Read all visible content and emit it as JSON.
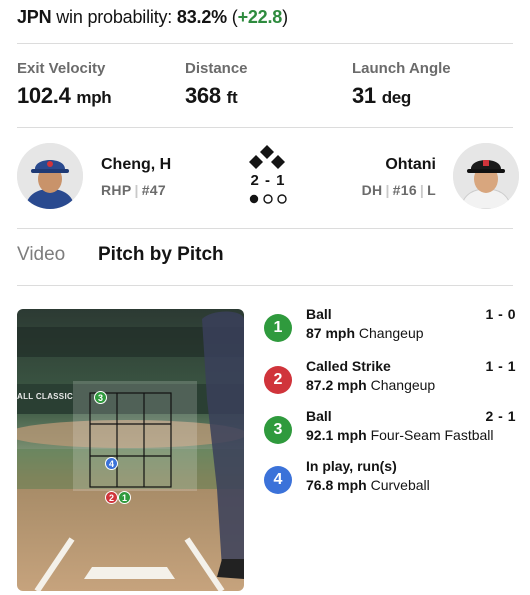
{
  "win_probability": {
    "team": "JPN",
    "label": "win probability:",
    "value": "83.2%",
    "open_paren": "(",
    "delta": "+22.8",
    "close_paren": ")",
    "delta_color": "#2e8b3e"
  },
  "stats": [
    {
      "label": "Exit Velocity",
      "value": "102.4",
      "unit": "mph"
    },
    {
      "label": "Distance",
      "value": "368",
      "unit": "ft"
    },
    {
      "label": "Launch Angle",
      "value": "31",
      "unit": "deg"
    }
  ],
  "pitcher": {
    "name": "Cheng, H",
    "position": "RHP",
    "number": "#47",
    "cap_color": "#2a4a8f"
  },
  "batter": {
    "name": "Ohtani",
    "position": "DH",
    "number": "#16",
    "bats": "L",
    "cap_color": "#1a1a1a"
  },
  "count": {
    "balls_strikes": "2 - 1",
    "outs": 1,
    "outs_max": 3,
    "bases_occupied": []
  },
  "tabs": [
    {
      "label": "Video",
      "active": false
    },
    {
      "label": "Pitch by Pitch",
      "active": true
    }
  ],
  "zone": {
    "signage": "ALL CLASSIC"
  },
  "pitches": [
    {
      "number": "1",
      "result": "Ball",
      "count": "1 - 0",
      "speed": "87 mph",
      "type": "Changeup",
      "color": "#2f9a3d"
    },
    {
      "number": "2",
      "result": "Called Strike",
      "count": "1 - 1",
      "speed": "87.2 mph",
      "type": "Changeup",
      "color": "#d0343b"
    },
    {
      "number": "3",
      "result": "Ball",
      "count": "2 - 1",
      "speed": "92.1 mph",
      "type": "Four-Seam Fastball",
      "color": "#2f9a3d"
    },
    {
      "number": "4",
      "result": "In play, run(s)",
      "count": "",
      "speed": "76.8 mph",
      "type": "Curveball",
      "color": "#3b72d9"
    }
  ]
}
